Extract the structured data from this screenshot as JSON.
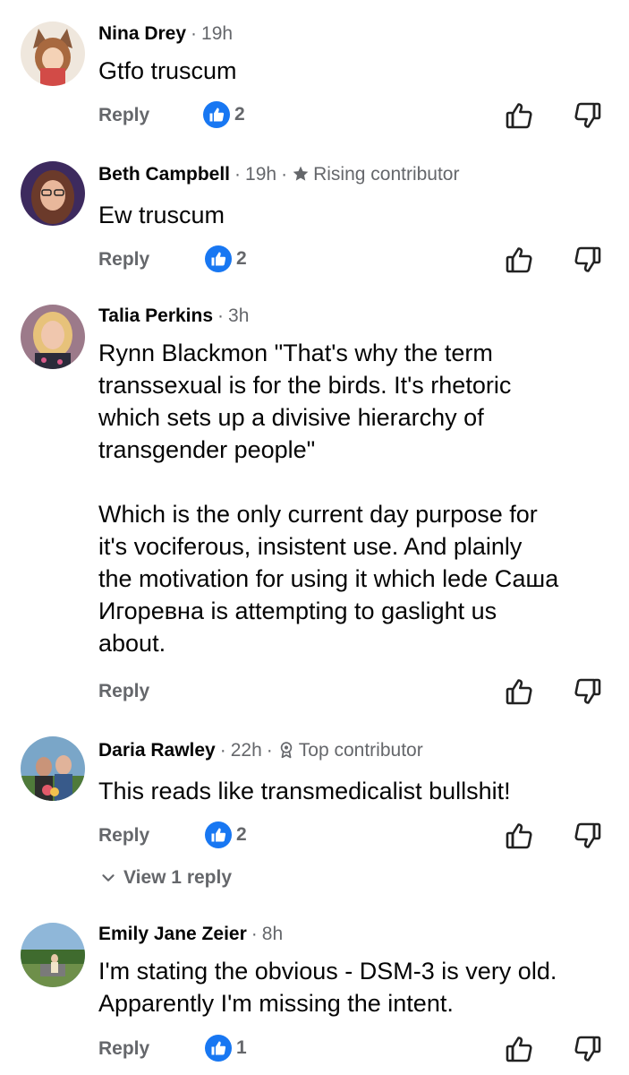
{
  "comments": [
    {
      "author": "Nina Drey",
      "time": "19h",
      "badge": "",
      "text": "Gtfo truscum",
      "reply_label": "Reply",
      "reaction_count": "2"
    },
    {
      "author": "Beth Campbell",
      "time": "19h",
      "badge": "Rising contributor",
      "text": "Ew truscum",
      "reply_label": "Reply",
      "reaction_count": "2"
    },
    {
      "author": "Talia Perkins",
      "time": "3h",
      "badge": "",
      "text": "Rynn Blackmon \"That's why the term\ntranssexual is for the birds. It's rhetoric\nwhich sets up a divisive hierarchy of\ntransgender people\"\n\nWhich is the only current day purpose for\nit's vociferous, insistent use.  And plainly\nthe motivation for using it which lede Саша\nИгоревна is attempting to gaslight us\nabout.",
      "reply_label": "Reply",
      "reaction_count": ""
    },
    {
      "author": "Daria Rawley",
      "time": "22h",
      "badge": "Top contributor",
      "text": "This reads like transmedicalist bullshit!",
      "reply_label": "Reply",
      "reaction_count": "2",
      "view_replies": "View 1 reply"
    },
    {
      "author": "Emily Jane Zeier",
      "time": "8h",
      "badge": "",
      "text": "I'm stating the obvious - DSM-3 is very old.\nApparently I'm missing the intent.",
      "reply_label": "Reply",
      "reaction_count": "1"
    }
  ],
  "icons": {
    "like_badge": "thumbs-up-icon",
    "upvote": "thumbs-up-outline-icon",
    "downvote": "thumbs-down-outline-icon",
    "rising_badge": "star-icon",
    "top_badge": "award-icon",
    "chevron": "chevron-down-icon"
  },
  "colors": {
    "accent": "#1877f2",
    "secondary_text": "#65676b",
    "primary_text": "#050505"
  }
}
